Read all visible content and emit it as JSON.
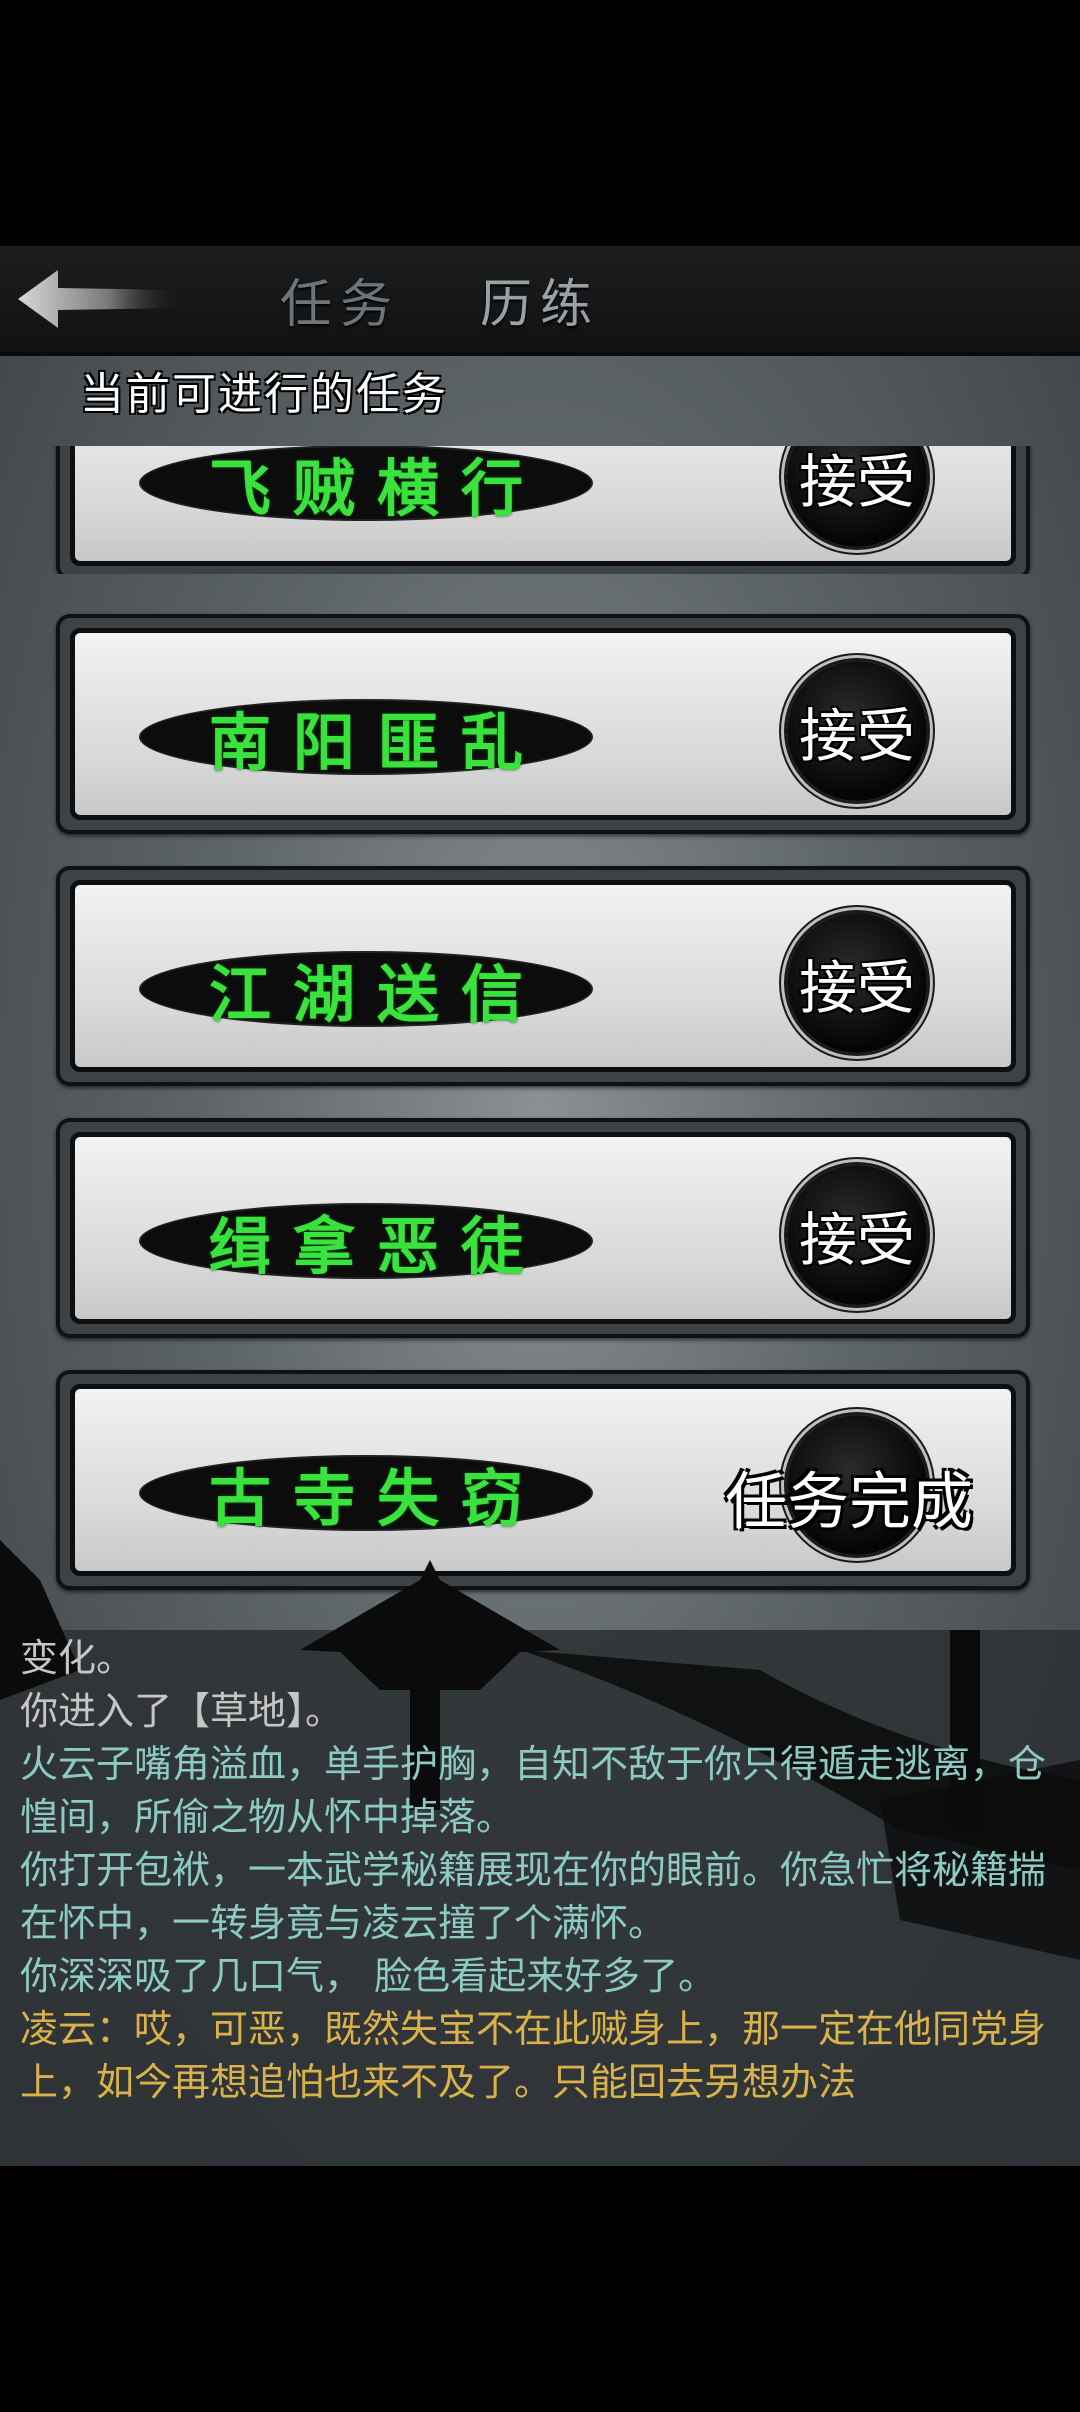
{
  "header": {
    "tab_task": "任务",
    "tab_training": "历练"
  },
  "section_title": "当前可进行的任务",
  "quests": [
    {
      "name": "飞贼横行",
      "action": "接受"
    },
    {
      "name": "南阳匪乱",
      "action": "接受"
    },
    {
      "name": "江湖送信",
      "action": "接受"
    },
    {
      "name": "缉拿恶徒",
      "action": "接受"
    },
    {
      "name": "古寺失窃",
      "action": "任务完成"
    }
  ],
  "log": [
    {
      "text": "变化。",
      "color": "gray"
    },
    {
      "text": "你进入了【草地】。",
      "color": "gray"
    },
    {
      "text": "火云子嘴角溢血，单手护胸，自知不敌于你只得遁走逃离，仓惶间，所偷之物从怀中掉落。",
      "color": "teal"
    },
    {
      "text": "你打开包袱，一本武学秘籍展现在你的眼前。你急忙将秘籍揣在怀中，一转身竟与凌云撞了个满怀。",
      "color": "teal"
    },
    {
      "text": "你深深吸了几口气， 脸色看起来好多了。",
      "color": "teal"
    },
    {
      "text": "凌云：哎，可恶，既然失宝不在此贼身上，那一定在他同党身上，如今再想追怕也来不及了。只能回去另想办法",
      "color": "gold"
    }
  ],
  "colors": {
    "quest_name": "#39e23c",
    "log_gray": "#c6c6c6",
    "log_teal": "#8ecac4",
    "log_gold": "#d9b24a"
  }
}
